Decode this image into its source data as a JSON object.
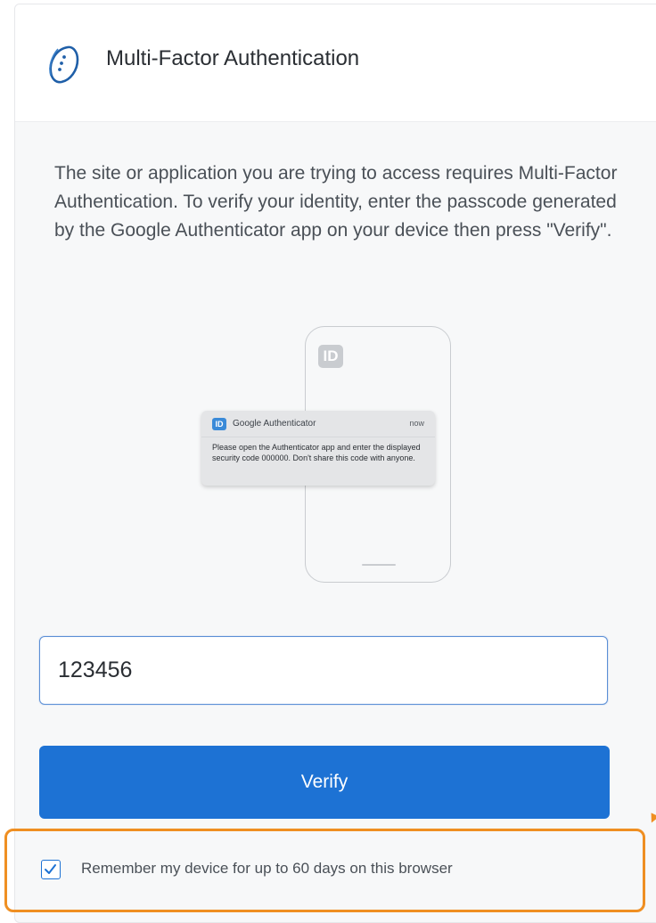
{
  "header": {
    "title": "Multi-Factor Authentication",
    "logo_icon": "okta-circle-logo-icon"
  },
  "description": "The site or application you are trying to access requires Multi-Factor Authentication. To verify your identity, enter the passcode generated by the Google Authenticator app on your device then press \"Verify\".",
  "illustration": {
    "phone_app_icon_label": "ID",
    "notification": {
      "app_icon_label": "ID",
      "app_name": "Google Authenticator",
      "time": "now",
      "body": "Please open the Authenticator app and enter the displayed security code 000000. Don't share this code with anyone."
    }
  },
  "passcode_input": {
    "value": "123456",
    "placeholder": ""
  },
  "verify_button": {
    "label": "Verify"
  },
  "remember_device": {
    "label": "Remember my device for up to 60 days on this browser",
    "checked": true
  },
  "colors": {
    "primary": "#1d72d4",
    "highlight": "#ef8f22",
    "card_background": "#f7f8f9"
  }
}
